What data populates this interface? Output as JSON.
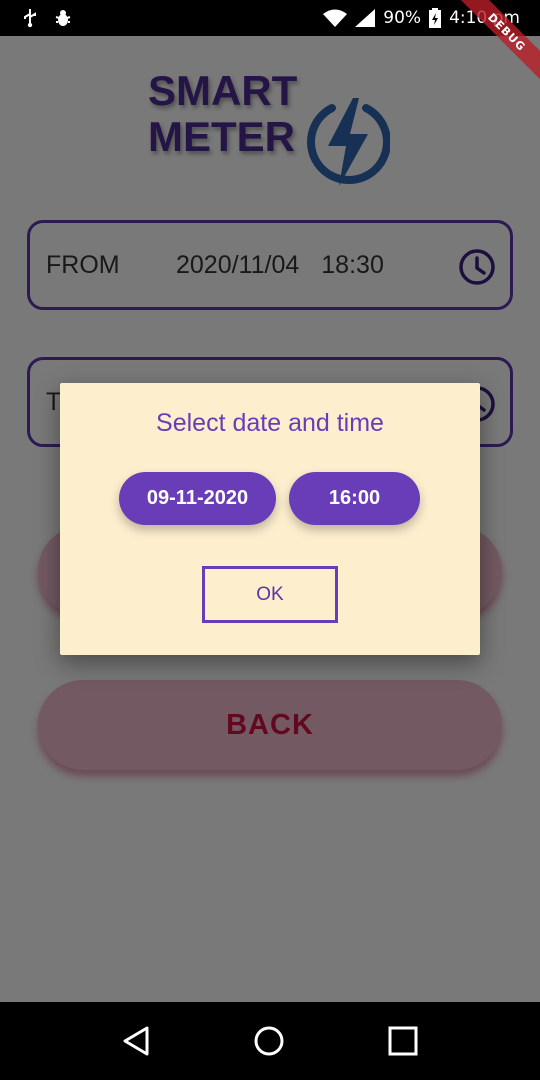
{
  "status_bar": {
    "battery_percent": "90%",
    "time": "4:10 pm",
    "left_icons": [
      "usb-icon",
      "bug-icon"
    ],
    "right_icons": [
      "wifi-icon",
      "signal-icon",
      "battery-charging-icon"
    ]
  },
  "debug_banner": "DEBUG",
  "logo": {
    "line1": "SMART",
    "line2": "METER",
    "icon": "lightning-bolt-icon"
  },
  "from_field": {
    "label": "FROM",
    "date": "2020/11/04",
    "time": "18:30",
    "icon": "clock-icon"
  },
  "to_field": {
    "label": "T",
    "icon": "clock-icon"
  },
  "back_button": {
    "label": "BACK"
  },
  "dialog": {
    "title": "Select date and time",
    "date_chip": "09-11-2020",
    "time_chip": "16:00",
    "ok_label": "OK"
  },
  "nav_bar": {
    "icons": [
      "back-triangle-icon",
      "home-circle-icon",
      "recents-square-icon"
    ]
  },
  "colors": {
    "accent": "#6a3db8",
    "dialog_bg": "#fdeece",
    "back_text": "#c4103f",
    "scrim": "rgba(0,0,0,0.5)"
  }
}
